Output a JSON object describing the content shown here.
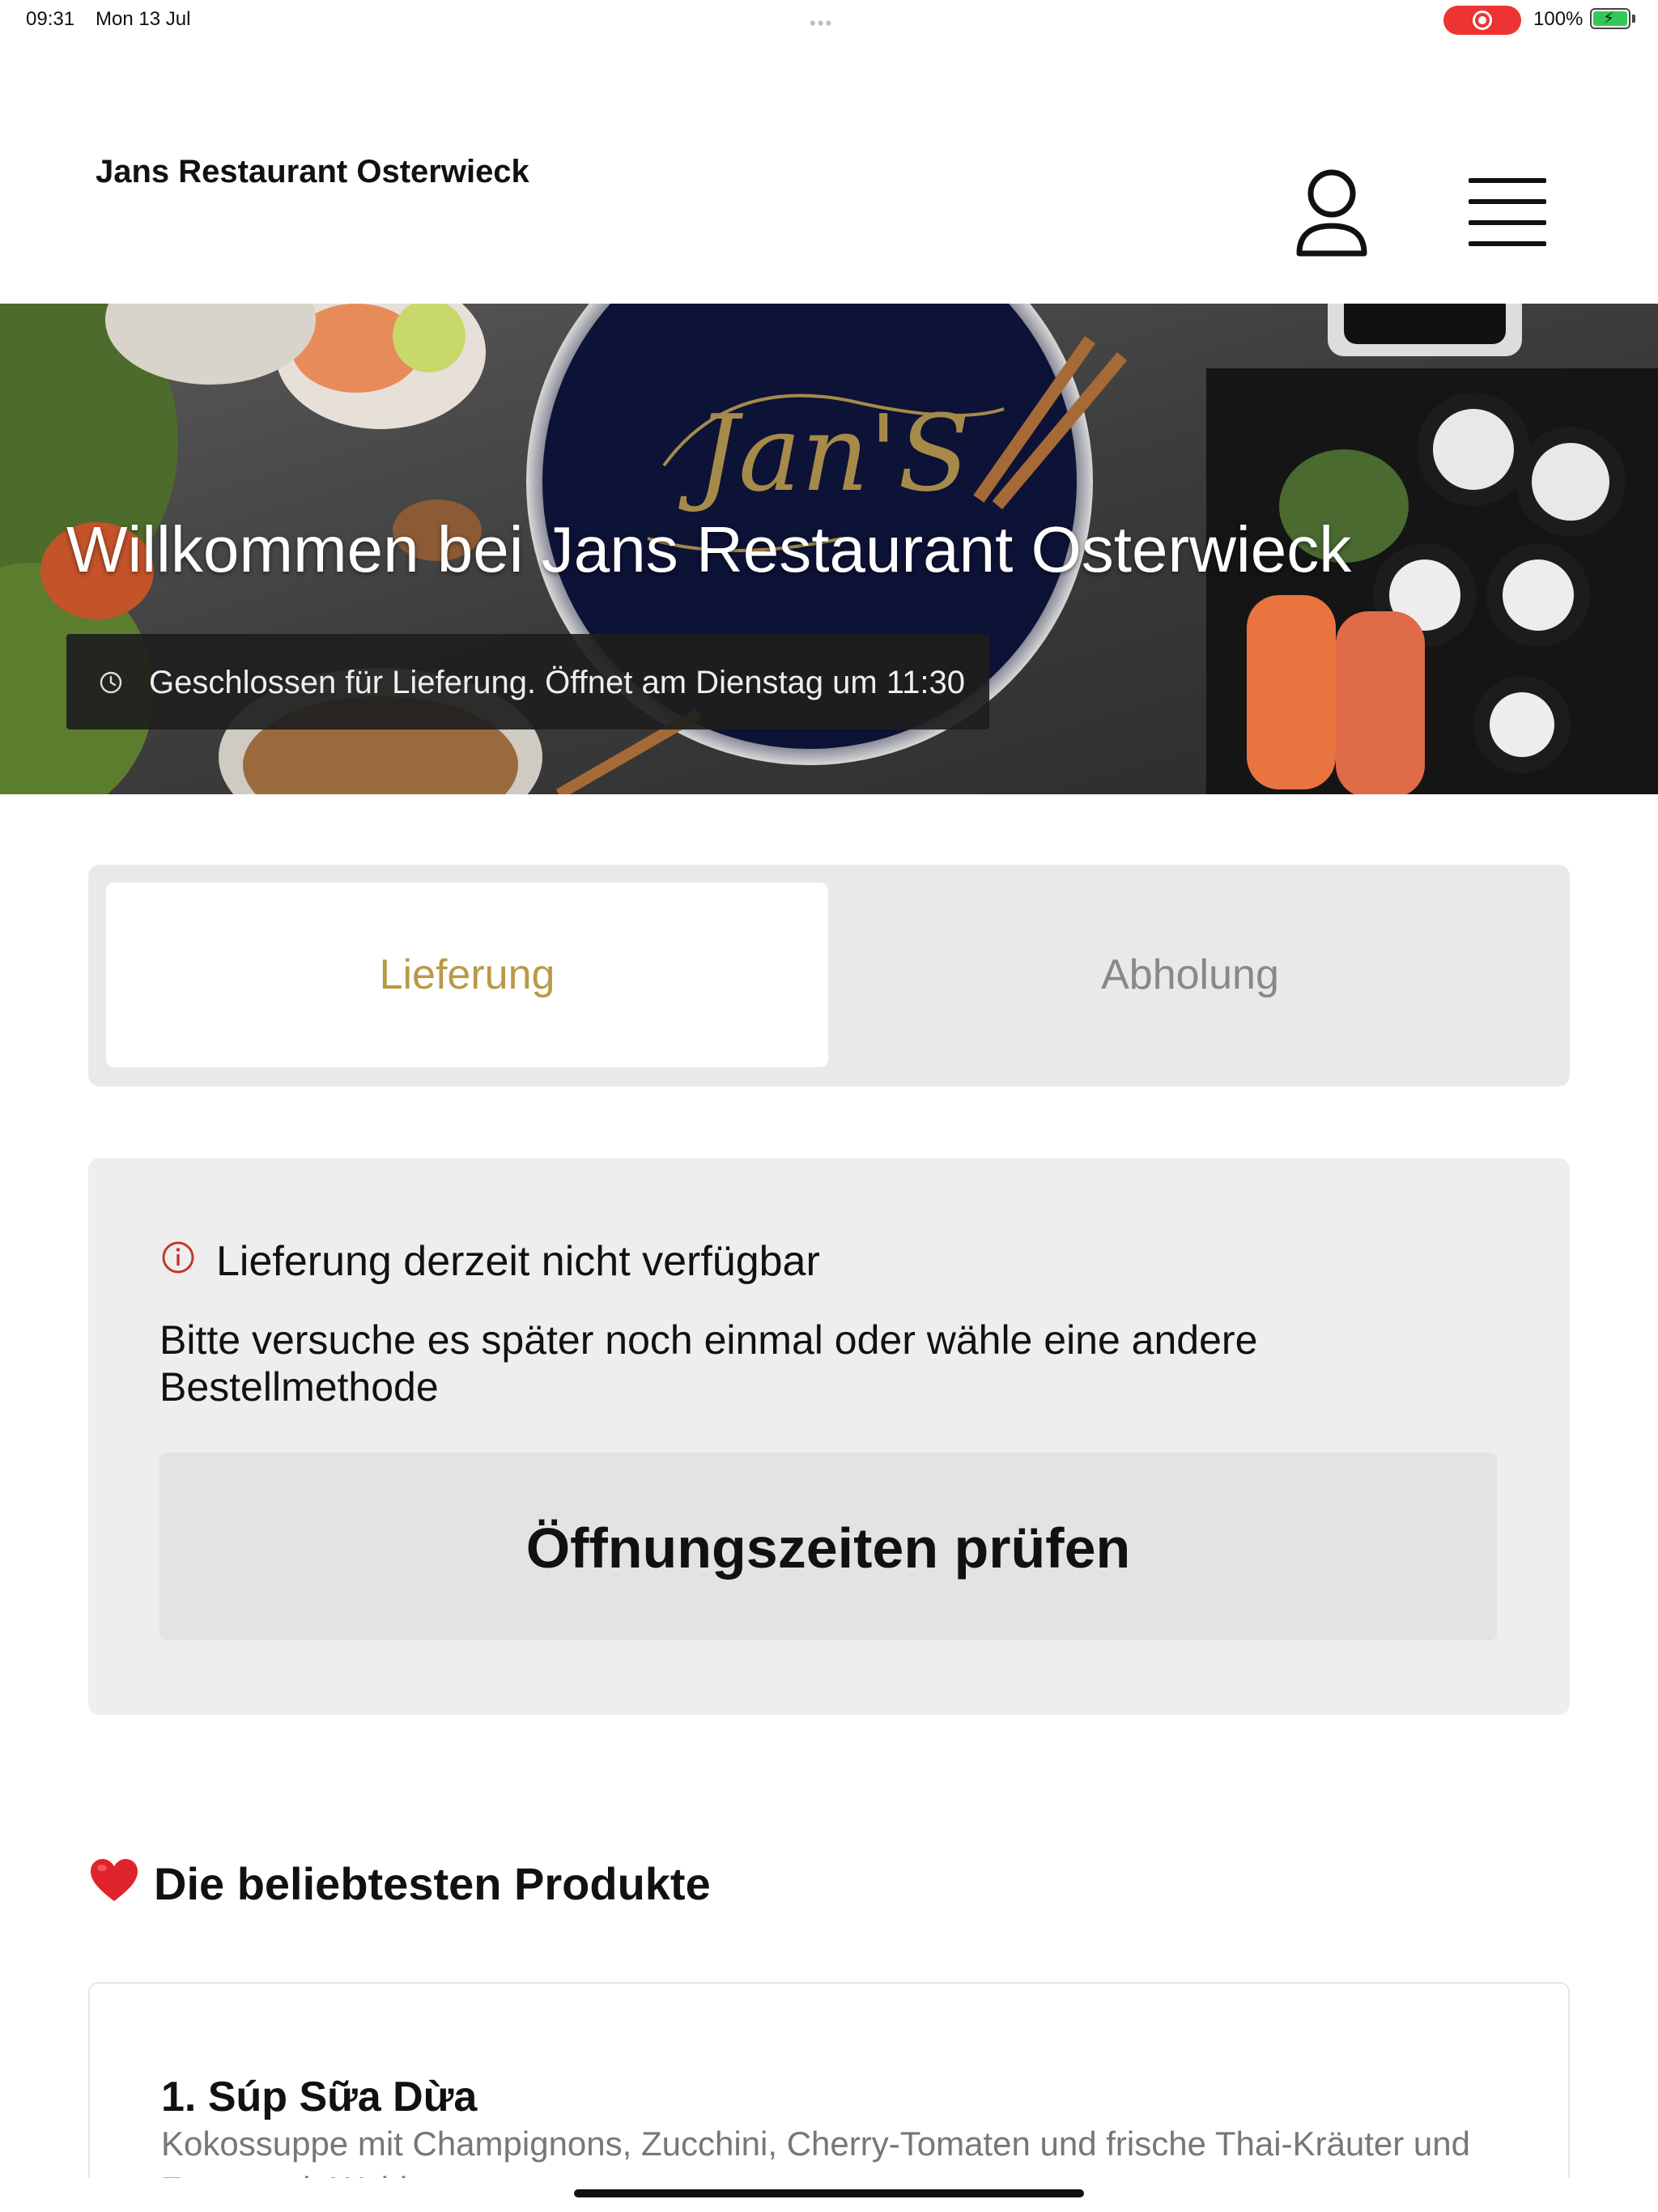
{
  "status_bar": {
    "time": "09:31",
    "date": "Mon 13 Jul",
    "battery_percent": "100%",
    "recording": true
  },
  "header": {
    "brand": "Jans Restaurant Osterwieck",
    "user_icon": "user-icon",
    "menu_icon": "hamburger-menu-icon"
  },
  "hero": {
    "title": "Willkommen bei Jans Restaurant Osterwieck",
    "logo_text": "Jan'S",
    "hours_status": "Geschlossen für Lieferung. Öffnet am Dienstag um 11:30",
    "clock_icon": "clock-icon"
  },
  "order_mode": {
    "selected": "Lieferung",
    "options": [
      "Lieferung",
      "Abholung"
    ]
  },
  "notice": {
    "icon": "info-icon",
    "title": "Lieferung derzeit nicht verfügbar",
    "body": "Bitte versuche es später noch einmal oder wähle eine andere Bestellmethode",
    "button_label": "Öffnungszeiten prüfen"
  },
  "popular": {
    "icon": "heart-icon",
    "title": "Die beliebtesten Produkte",
    "items": [
      {
        "name": "1. Súp Sữa Dừa",
        "description": "Kokossuppe mit Champignons, Zucchini, Cherry-Tomaten und frische Thai-Kräuter und Zutat nach Wahl"
      }
    ]
  },
  "colors": {
    "accent_gold": "#b89a45",
    "pill_bg": "#1e1e1e",
    "card_bg": "#eeeeee",
    "notice_icon": "#c0392b",
    "recording": "#e33333",
    "battery": "#36c759"
  }
}
